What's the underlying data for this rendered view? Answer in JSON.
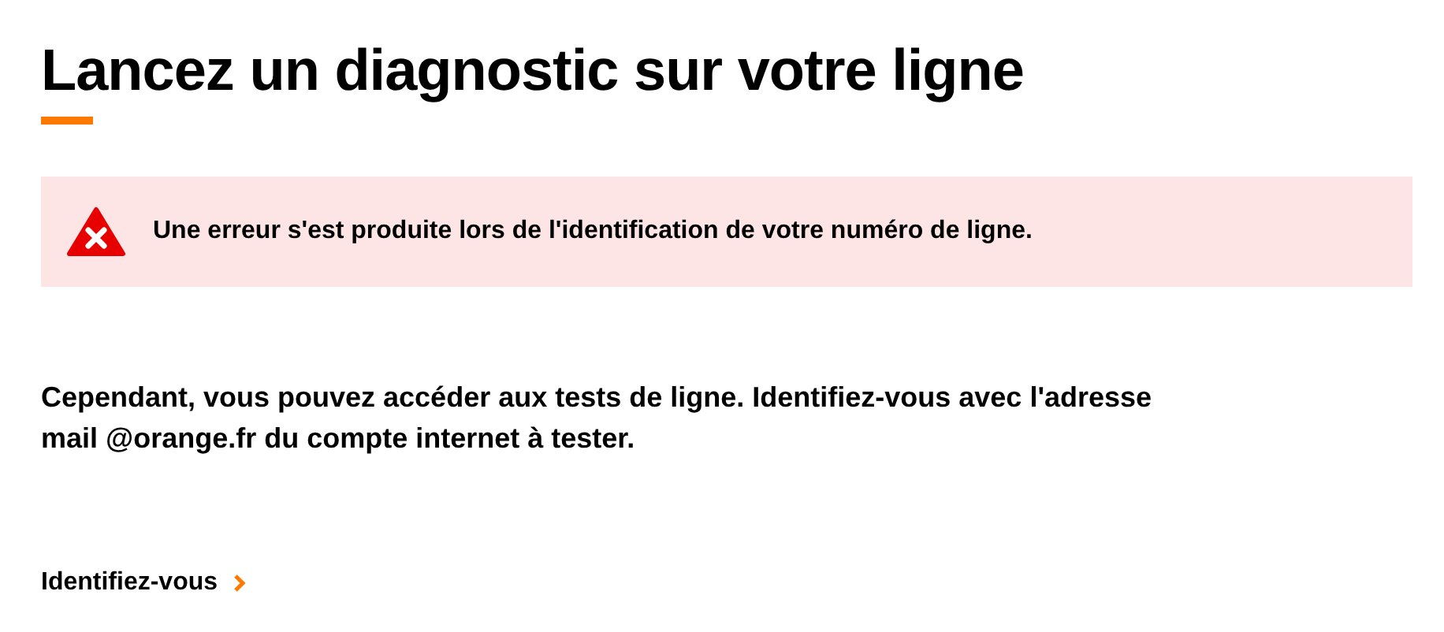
{
  "title": "Lancez un diagnostic sur votre ligne",
  "alert": {
    "message": "Une erreur s'est produite lors de l'identification de votre numéro de ligne."
  },
  "paragraph": "Cependant, vous pouvez accéder aux tests de ligne. Identifiez-vous avec l'adresse mail @orange.fr du compte internet à tester.",
  "link": {
    "label": "Identifiez-vous"
  }
}
